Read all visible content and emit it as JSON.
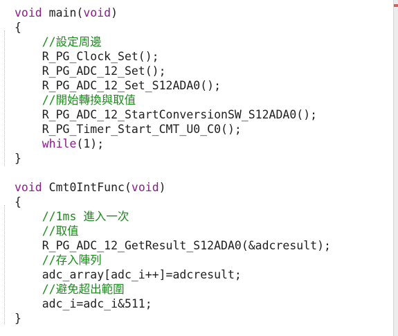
{
  "editor": {
    "indent": "    ",
    "lines": [
      [
        {
          "t": "void",
          "c": "kw"
        },
        {
          "t": " main(",
          "c": "pl"
        },
        {
          "t": "void",
          "c": "kw"
        },
        {
          "t": ")",
          "c": "pl"
        }
      ],
      [
        {
          "t": "{",
          "c": "pl"
        }
      ],
      [
        {
          "t": "    //設定周邊",
          "c": "cm"
        }
      ],
      [
        {
          "t": "    R_PG_Clock_Set();",
          "c": "pl"
        }
      ],
      [
        {
          "t": "    R_PG_ADC_12_Set();",
          "c": "pl"
        }
      ],
      [
        {
          "t": "    R_PG_ADC_12_Set_S12ADA0();",
          "c": "pl"
        }
      ],
      [
        {
          "t": "    //開始轉換與取值",
          "c": "cm"
        }
      ],
      [
        {
          "t": "    R_PG_ADC_12_StartConversionSW_S12ADA0();",
          "c": "pl"
        }
      ],
      [
        {
          "t": "    R_PG_Timer_Start_CMT_U0_C0();",
          "c": "pl"
        }
      ],
      [
        {
          "t": "    ",
          "c": "pl"
        },
        {
          "t": "while",
          "c": "kw"
        },
        {
          "t": "(1);",
          "c": "pl"
        }
      ],
      [
        {
          "t": "}",
          "c": "pl"
        }
      ],
      [],
      [
        {
          "t": "void",
          "c": "kw"
        },
        {
          "t": " Cmt0IntFunc(",
          "c": "pl"
        },
        {
          "t": "void",
          "c": "kw"
        },
        {
          "t": ")",
          "c": "pl"
        }
      ],
      [
        {
          "t": "{",
          "c": "pl"
        }
      ],
      [
        {
          "t": "    //1ms 進入一次",
          "c": "cm"
        }
      ],
      [
        {
          "t": "    //取值",
          "c": "cm"
        }
      ],
      [
        {
          "t": "    R_PG_ADC_12_GetResult_S12ADA0(&adcresult);",
          "c": "pl"
        }
      ],
      [
        {
          "t": "    //存入陣列",
          "c": "cm"
        }
      ],
      [
        {
          "t": "    adc_array[adc_i++]=adcresult;",
          "c": "pl"
        }
      ],
      [
        {
          "t": "    //避免超出範圍",
          "c": "cm"
        }
      ],
      [
        {
          "t": "    adc_i=adc_i&511;",
          "c": "pl"
        }
      ],
      [
        {
          "t": "}",
          "c": "pl"
        }
      ]
    ]
  },
  "colors": {
    "keyword": "#8b1a8b",
    "comment": "#1a8c1a",
    "plain": "#202020",
    "background": "#ffffff"
  }
}
